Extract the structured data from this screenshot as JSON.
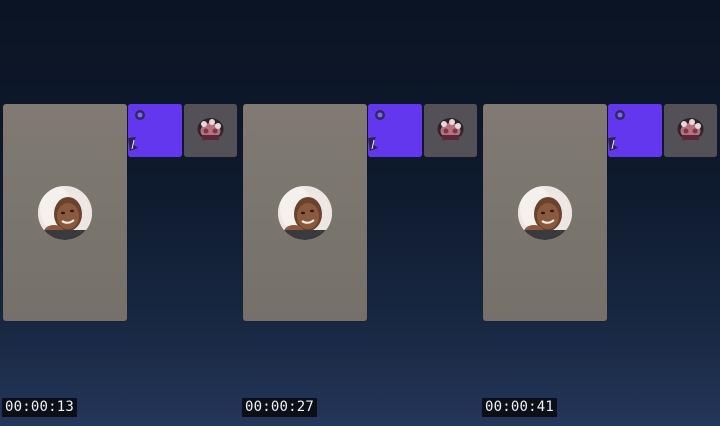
{
  "frames": [
    {
      "timestamp": "00:00:13",
      "avatar_icon": "user-avatar-photo",
      "thumbs": [
        "video-thumbnail",
        "emoji-avatar-thumbnail"
      ]
    },
    {
      "timestamp": "00:00:27",
      "avatar_icon": "user-avatar-photo",
      "thumbs": [
        "video-thumbnail",
        "emoji-avatar-thumbnail"
      ]
    },
    {
      "timestamp": "00:00:41",
      "avatar_icon": "user-avatar-photo",
      "thumbs": [
        "video-thumbnail",
        "emoji-avatar-thumbnail"
      ]
    }
  ],
  "colors": {
    "background_top": "#0b1424",
    "background_bottom": "#24365a",
    "main_tile": "#7c776f",
    "video_thumb": "#6a3ef2",
    "photo_thumb": "#545057",
    "timestamp_bg": "#0a0f18",
    "timestamp_text": "#f1f1f1"
  }
}
